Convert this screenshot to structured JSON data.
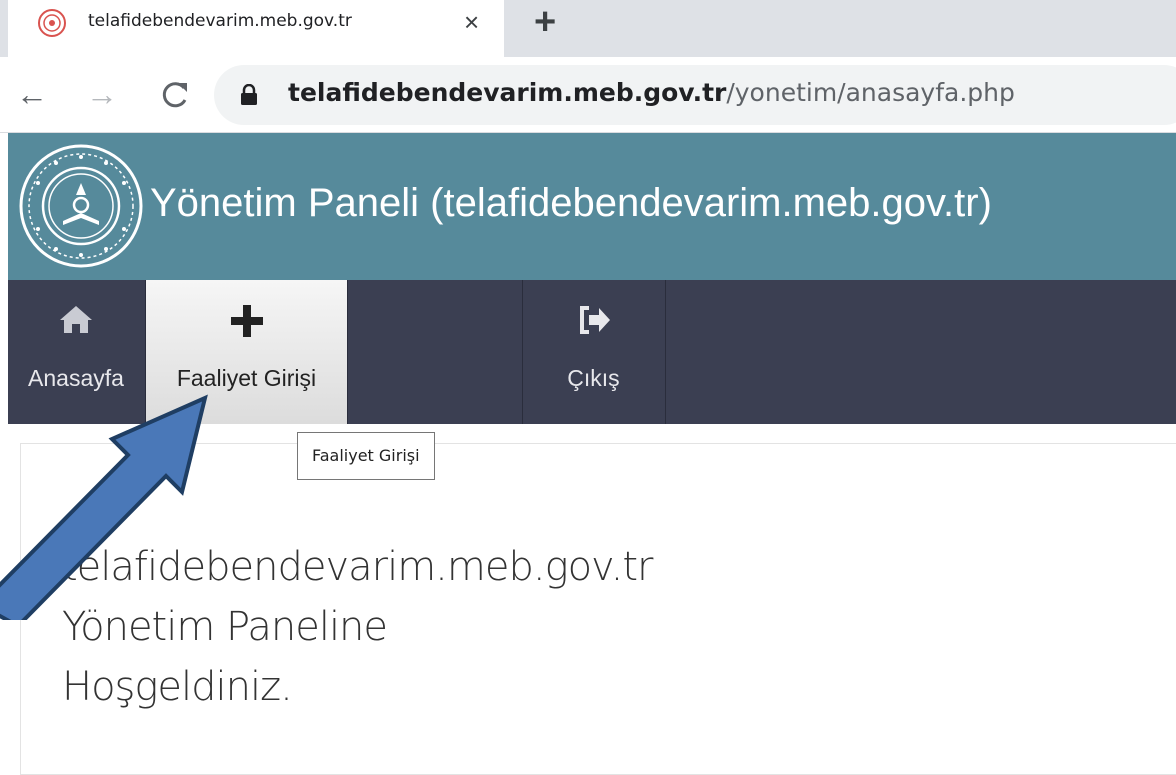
{
  "browser": {
    "tab_title": "telafidebendevarim.meb.gov.tr",
    "tab_close": "×",
    "new_tab": "+",
    "url_host": "telafidebendevarim.meb.gov.tr",
    "url_path": "/yonetim/anasayfa.php",
    "back": "←",
    "forward": "→",
    "reload": "C"
  },
  "header": {
    "title": "Yönetim Paneli (telafidebendevarim.meb.gov.tr)",
    "background": "#568a9b"
  },
  "nav": {
    "items": [
      {
        "label": "Anasayfa",
        "icon": "home-icon"
      },
      {
        "label": "Faaliyet Girişi",
        "icon": "plus-icon",
        "active": true
      },
      {
        "label": "Çıkış",
        "icon": "sign-out-icon"
      }
    ],
    "background": "#3b3f52"
  },
  "tooltip": "Faaliyet Girişi",
  "content": {
    "welcome_lines": [
      "telafidebendevarim.meb.gov.tr",
      "Yönetim Paneline",
      "Hoşgeldiniz."
    ]
  },
  "annotation": {
    "arrow_color": "#4a78b8",
    "arrow_icon": "pointer-arrow-icon"
  }
}
